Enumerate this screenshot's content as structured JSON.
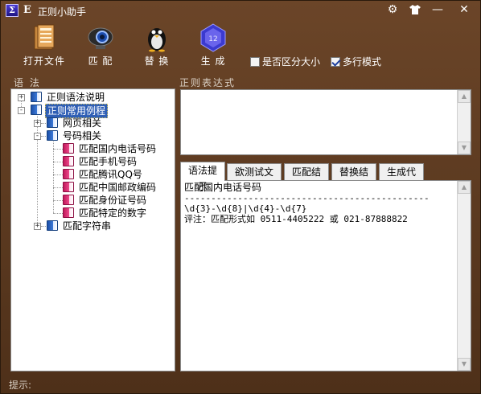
{
  "window": {
    "title": "正则小助手",
    "app_letter": "E",
    "icon_glyph": "Σ"
  },
  "titlebar_buttons": [
    {
      "name": "gear-icon",
      "glyph": "⚙"
    },
    {
      "name": "shirt-icon",
      "glyph": "👕"
    },
    {
      "name": "minimize-icon",
      "glyph": "—"
    },
    {
      "name": "close-icon",
      "glyph": "✕"
    }
  ],
  "toolbar": {
    "open_file": "打开文件",
    "match": "匹 配",
    "replace": "替 换",
    "generate": "生 成",
    "case_sensitive": {
      "label": "是否区分大小",
      "checked": false
    },
    "multiline": {
      "label": "多行模式",
      "checked": true
    }
  },
  "sections": {
    "syntax": "语 法",
    "regex": "正则表达式"
  },
  "tree": {
    "nodes": [
      {
        "label": "正则语法说明",
        "level": 0,
        "expander": "+",
        "icon": "blue",
        "selected": false
      },
      {
        "label": "正则常用例程",
        "level": 0,
        "expander": "-",
        "icon": "blue",
        "selected": true
      },
      {
        "label": "网页相关",
        "level": 1,
        "expander": "+",
        "icon": "blue",
        "selected": false
      },
      {
        "label": "号码相关",
        "level": 1,
        "expander": "-",
        "icon": "blue",
        "selected": false
      },
      {
        "label": "匹配国内电话号码",
        "level": 2,
        "expander": "",
        "icon": "pink",
        "selected": false
      },
      {
        "label": "匹配手机号码",
        "level": 2,
        "expander": "",
        "icon": "pink",
        "selected": false
      },
      {
        "label": "匹配腾讯QQ号",
        "level": 2,
        "expander": "",
        "icon": "pink",
        "selected": false
      },
      {
        "label": "匹配中国邮政编码",
        "level": 2,
        "expander": "",
        "icon": "pink",
        "selected": false
      },
      {
        "label": "匹配身份证号码",
        "level": 2,
        "expander": "",
        "icon": "pink",
        "selected": false
      },
      {
        "label": "匹配特定的数字",
        "level": 2,
        "expander": "",
        "icon": "pink",
        "selected": false
      },
      {
        "label": "匹配字符串",
        "level": 1,
        "expander": "+",
        "icon": "blue",
        "selected": false
      }
    ]
  },
  "regex_input": {
    "value": ""
  },
  "tabs": [
    {
      "label": "语法提示",
      "active": true
    },
    {
      "label": "欲测试文本",
      "active": false
    },
    {
      "label": "匹配结果",
      "active": false
    },
    {
      "label": "替换结果",
      "active": false
    },
    {
      "label": "生成代码",
      "active": false
    }
  ],
  "tab_content": {
    "title": "匹配国内电话号码",
    "divider": "----------------------------------------------",
    "pattern": "\\d{3}-\\d{8}|\\d{4}-\\d{7}",
    "comment": "评注：匹配形式如 0511-4405222 或 021-87888822"
  },
  "status": {
    "label": "提示:"
  },
  "colors": {
    "frame": "#5a3a22",
    "selection": "#2f5fb5",
    "label_text": "#d9cfc4"
  }
}
